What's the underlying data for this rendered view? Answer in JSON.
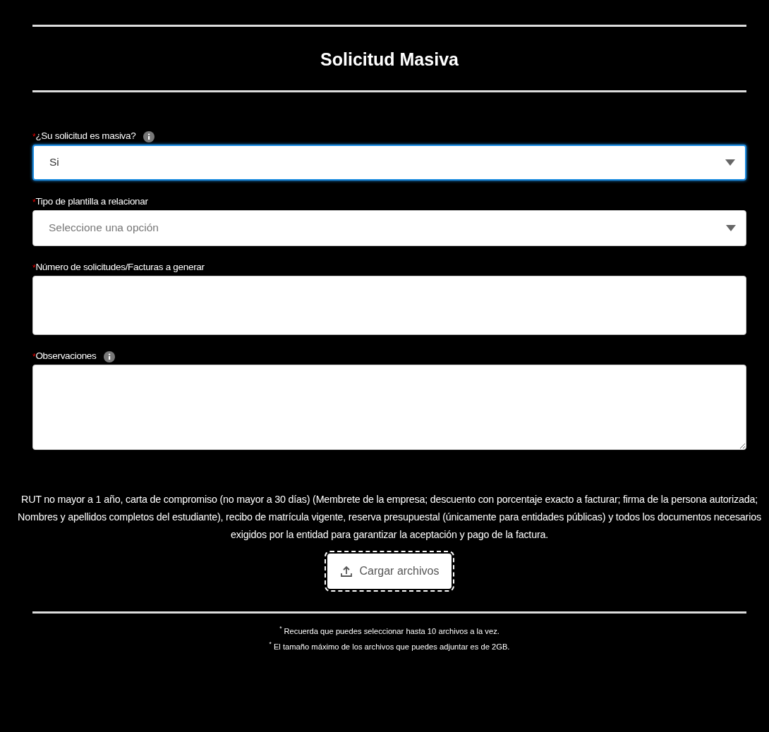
{
  "title": "Solicitud Masiva",
  "fields": [
    {
      "kind": "select",
      "label": "¿Su solicitud es masiva?",
      "asterisk": "*",
      "info": true,
      "focused": true,
      "value": "Si"
    },
    {
      "kind": "select",
      "label": "Tipo de plantilla a relacionar",
      "asterisk": "*",
      "info": false,
      "focused": false,
      "placeholder": "Seleccione una opción"
    },
    {
      "kind": "input",
      "label": "Número de solicitudes/Facturas a generar",
      "asterisk": "*",
      "info": false,
      "focused": false
    },
    {
      "kind": "textarea",
      "label": "Observaciones",
      "asterisk": "*",
      "info": true,
      "focused": false
    }
  ],
  "requirements": "RUT no mayor a 1 año, carta de compromiso (no mayor a 30 días) (Membrete de la empresa; descuento con porcentaje exacto a facturar; firma de la persona autorizada; Nombres y apellidos completos del estudiante), recibo de matrícula vigente, reserva presupuestal (únicamente para entidades públicas) y todos los documentos necesarios exigidos por la entidad para garantizar la aceptación y pago de la factura.",
  "upload_button": "Cargar archivos",
  "notes": [
    "$^{*}$ Recuerda que puedes seleccionar hasta 10 archivos a la vez.",
    "$^{*}$ El tamaño máximo de los archivos que puedes adjuntar es de 2GB."
  ]
}
